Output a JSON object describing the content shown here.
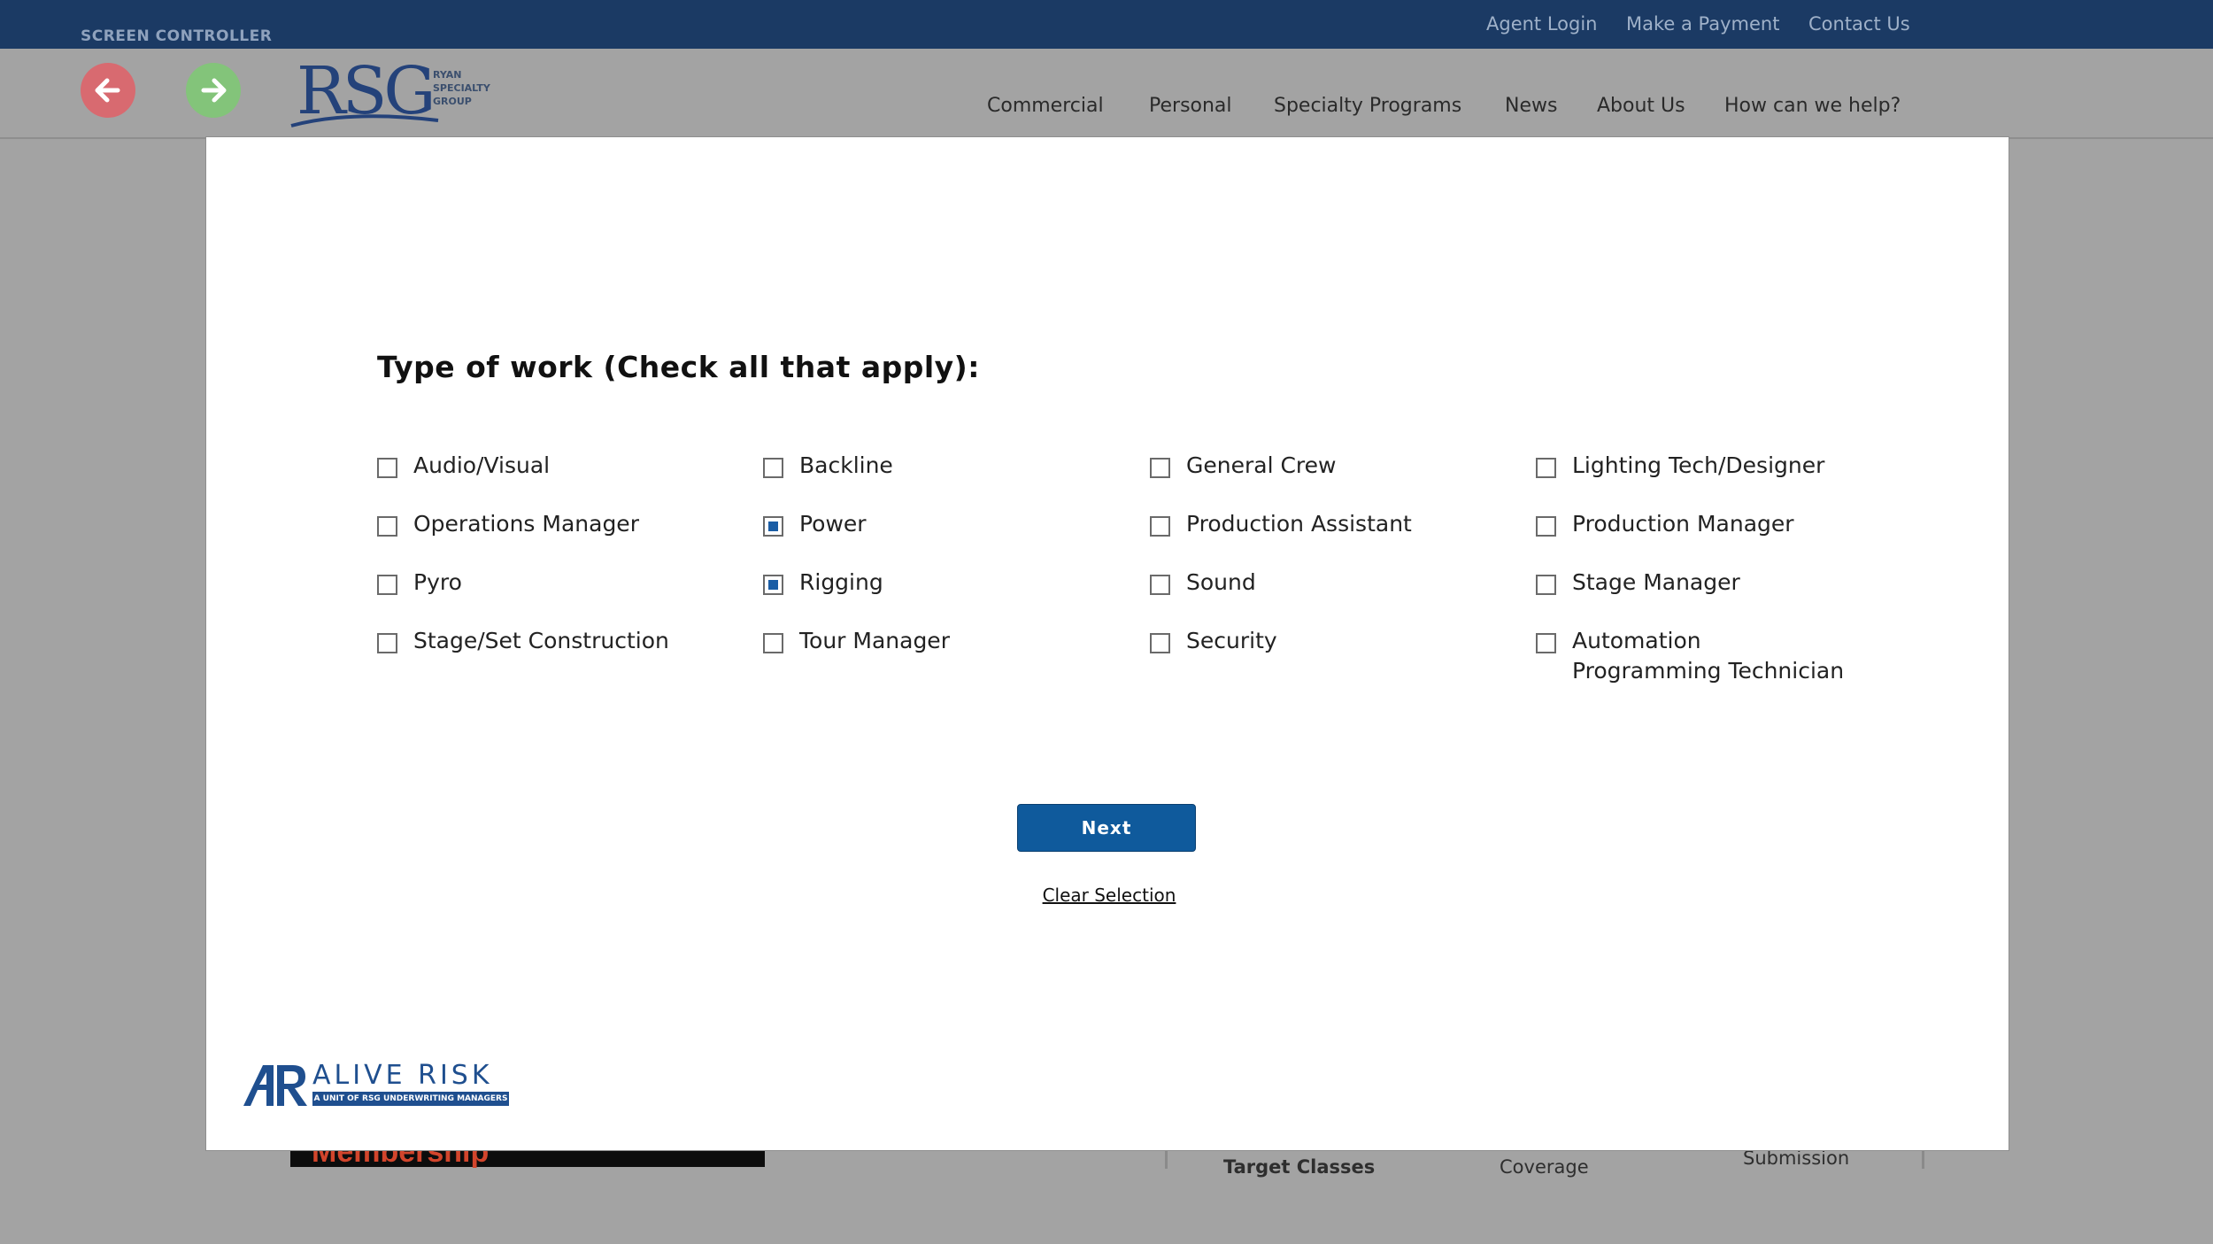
{
  "topbar": {
    "screen_controller": "SCREEN CONTROLLER",
    "links": [
      "Agent Login",
      "Make a Payment",
      "Contact Us"
    ]
  },
  "header": {
    "back_icon": "arrow-left-icon",
    "forward_icon": "arrow-right-icon",
    "logo_main": "RSG",
    "logo_sub": "RYAN SPECIALTY GROUP",
    "nav": [
      "Commercial",
      "Personal",
      "Specialty Programs",
      "News",
      "About Us",
      "How can we help?"
    ]
  },
  "background": {
    "dark_banner_text": "Membership",
    "col1": "Target Classes",
    "col2": "Coverage",
    "col3": "Submission"
  },
  "modal": {
    "question": "Type of work (Check all that apply):",
    "options": [
      {
        "label": "Audio/Visual",
        "checked": false
      },
      {
        "label": "Backline",
        "checked": false
      },
      {
        "label": "General Crew",
        "checked": false
      },
      {
        "label": "Lighting Tech/Designer",
        "checked": false
      },
      {
        "label": "Operations Manager",
        "checked": false
      },
      {
        "label": "Power",
        "checked": true
      },
      {
        "label": "Production Assistant",
        "checked": false
      },
      {
        "label": "Production Manager",
        "checked": false
      },
      {
        "label": "Pyro",
        "checked": false
      },
      {
        "label": "Rigging",
        "checked": true
      },
      {
        "label": "Sound",
        "checked": false
      },
      {
        "label": "Stage Manager",
        "checked": false
      },
      {
        "label": "Stage/Set Construction",
        "checked": false
      },
      {
        "label": "Tour Manager",
        "checked": false
      },
      {
        "label": "Security",
        "checked": false
      },
      {
        "label": "Automation Programming Technician",
        "checked": false
      }
    ],
    "next_label": "Next",
    "clear_label": "Clear Selection",
    "footer_logo": {
      "name": "ALIVE RISK",
      "tagline": "A UNIT OF RSG UNDERWRITING MANAGERS"
    }
  },
  "colors": {
    "topbar": "#1b3a64",
    "accent": "#0f5a9c",
    "back_button": "#d86a70",
    "forward_button": "#83c47a"
  }
}
